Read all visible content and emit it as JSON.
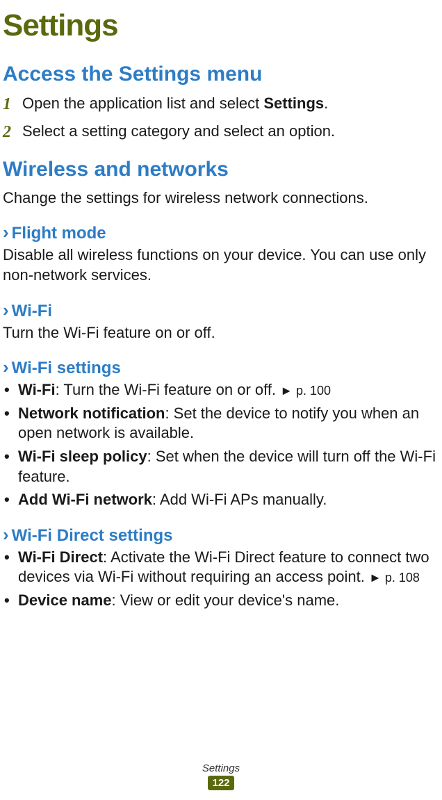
{
  "header": {
    "title": "Settings"
  },
  "sections": {
    "accessMenu": {
      "title": "Access the Settings menu",
      "step1_num": "1",
      "step1_pre": "Open the application list and select ",
      "step1_bold": "Settings",
      "step1_post": ".",
      "step2_num": "2",
      "step2_text": "Select a setting category and select an option."
    },
    "wireless": {
      "title": "Wireless and networks",
      "intro": "Change the settings for wireless network connections."
    },
    "flightMode": {
      "title": "Flight mode",
      "body": "Disable all wireless functions on your device. You can use only non-network services."
    },
    "wifi": {
      "title": "Wi-Fi",
      "body": "Turn the Wi-Fi feature on or off."
    },
    "wifiSettings": {
      "title": "Wi-Fi settings",
      "items": [
        {
          "bold": "Wi-Fi",
          "text": ": Turn the Wi-Fi feature on or off. ",
          "ref": "► p. 100"
        },
        {
          "bold": "Network notification",
          "text": ": Set the device to notify you when an open network is available.",
          "ref": ""
        },
        {
          "bold": "Wi-Fi sleep policy",
          "text": ": Set when the device will turn off the Wi-Fi feature.",
          "ref": ""
        },
        {
          "bold": "Add Wi-Fi network",
          "text": ": Add Wi-Fi APs manually.",
          "ref": ""
        }
      ]
    },
    "wifiDirect": {
      "title": "Wi-Fi Direct settings",
      "items": [
        {
          "bold": "Wi-Fi Direct",
          "text": ": Activate the Wi-Fi Direct feature to connect two devices via Wi-Fi without requiring an access point. ",
          "ref": "► p. 108"
        },
        {
          "bold": "Device name",
          "text": ": View or edit your device's name.",
          "ref": ""
        }
      ]
    }
  },
  "footer": {
    "label": "Settings",
    "page": "122"
  }
}
